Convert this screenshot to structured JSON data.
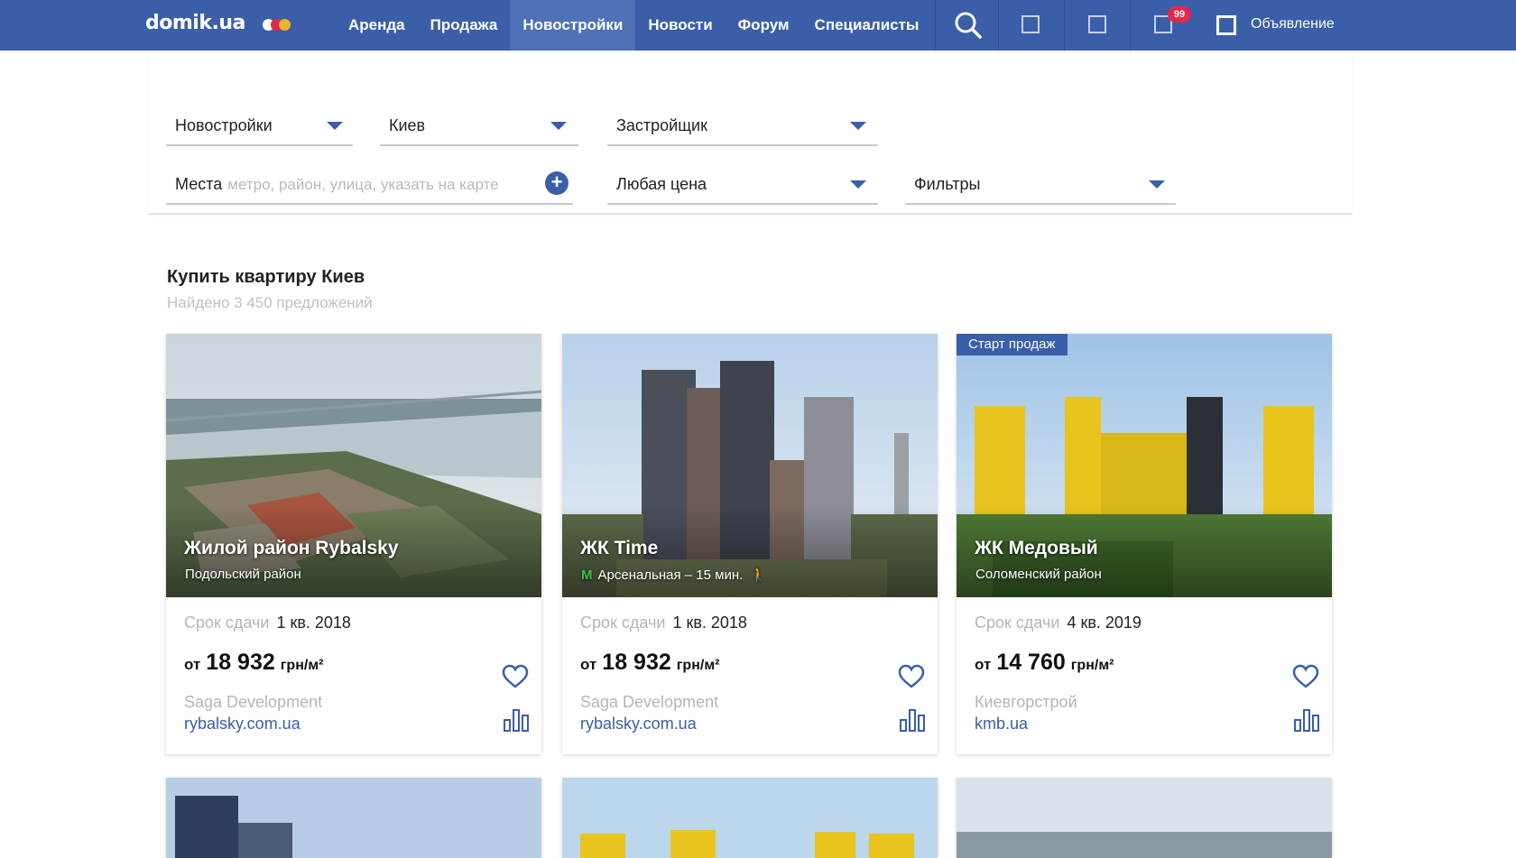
{
  "brand": {
    "logo_text": "domik.ua",
    "dot_colors": [
      "#e6274a",
      "#f0b429",
      "#8a8f9c"
    ]
  },
  "nav": {
    "items": [
      {
        "label": "Аренда",
        "active": false
      },
      {
        "label": "Продажа",
        "active": false
      },
      {
        "label": "Новостройки",
        "active": true
      },
      {
        "label": "Новости",
        "active": false
      },
      {
        "label": "Форум",
        "active": false
      },
      {
        "label": "Специалисты",
        "active": false
      }
    ],
    "icons": [
      "search-icon",
      "square-icon",
      "square-icon",
      "square-icon"
    ],
    "badge_count": "99",
    "announcement_label": "Объявление"
  },
  "filters": {
    "category": "Новостройки",
    "city": "Киев",
    "developer": "Застройщик",
    "places_label": "Места",
    "places_placeholder": "метро, район, улица, указать на карте",
    "price": "Любая цена",
    "more": "Фильтры"
  },
  "results": {
    "title": "Купить квартиру Киев",
    "count_text": "Найдено 3 450 предложений"
  },
  "cards": [
    {
      "name": "Жилой район Rybalsky",
      "location": "Подольский район",
      "deadline_label": "Срок сдачи",
      "deadline": "1 кв. 2018",
      "price_from": "от",
      "price": "18 932",
      "price_unit": "грн/м²",
      "developer": "Saga Development",
      "site": "rybalsky.com.ua"
    },
    {
      "name": "ЖК Time",
      "location": "Арсенальная – 15 мин.",
      "metro_icon": "metro-m",
      "deadline_label": "Срок сдачи",
      "deadline": "1 кв. 2018",
      "price_from": "от",
      "price": "18 932",
      "price_unit": "грн/м²",
      "developer": "Saga Development",
      "site": "rybalsky.com.ua"
    },
    {
      "tag": "Старт продаж",
      "name": "ЖК Медовый",
      "location": "Соломенский район",
      "deadline_label": "Срок сдачи",
      "deadline": "4 кв. 2019",
      "price_from": "от",
      "price": "14 760",
      "price_unit": "грн/м²",
      "developer": "Киевгорстрой",
      "site": "kmb.ua"
    }
  ],
  "colors": {
    "brand_blue": "#3a5ea8",
    "badge_red": "#e6274a",
    "metro_green": "#3fbf4a"
  }
}
